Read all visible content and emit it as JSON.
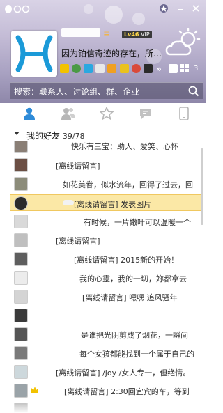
{
  "header": {
    "nickname_suffix": "≡",
    "level_badge": "Lv46",
    "vip_badge": "VIP",
    "signature": "因为铂信奇迹的存在，所…",
    "apps_count": "3"
  },
  "search": {
    "label": "搜索：联系人、讨论组、群、企业"
  },
  "tabs": [
    {
      "icon": "contact-icon"
    },
    {
      "icon": "group-icon"
    },
    {
      "icon": "star-icon"
    },
    {
      "icon": "chat-icon"
    },
    {
      "icon": "phone-icon"
    }
  ],
  "group": {
    "name": "我的好友",
    "count": "39/78"
  },
  "contacts": [
    {
      "text": "快乐有三宝：助人、爱笑、心怀"
    },
    {
      "text": "[离线请留言]"
    },
    {
      "text": "如花美眷，似水流年，回得了过去，回"
    },
    {
      "text": "[离线请留言]  发表图片"
    },
    {
      "text": "有时候，一片嫩叶可以温暖一个"
    },
    {
      "text": "[离线请留言]"
    },
    {
      "text": "[离线请留言]  2015新的开始！"
    },
    {
      "text": "我的心靈，我的一切，妳都拿去"
    },
    {
      "text": "[离线请留言]  嘿嘿 追风骚年"
    },
    {
      "text": ""
    },
    {
      "text": "是谁把光阴剪成了烟花，一瞬间"
    },
    {
      "text": "每个女孩都能找到一个属于自己的"
    },
    {
      "text": "[离线请留言]  /joy /女人专一，但绝情。"
    },
    {
      "text": "[离线请留言]  2:30回宜宾的车，等到"
    },
    {
      "text": ""
    }
  ],
  "colors": {
    "accent": "#3b8fd6",
    "selected_row": "#fbe8a6",
    "search_bar": "#575270"
  }
}
